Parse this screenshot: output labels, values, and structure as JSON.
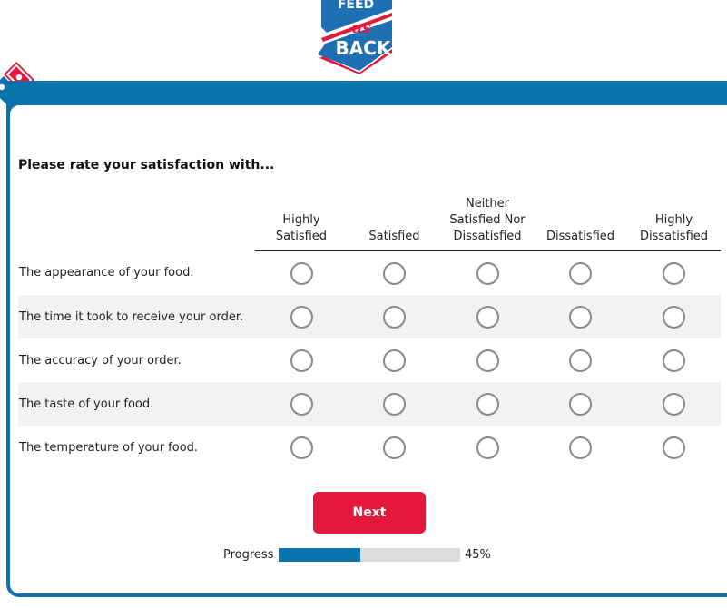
{
  "brand": {
    "logo_lines": [
      "FEED",
      "us",
      "BACK"
    ],
    "accent_blue": "#0b73ab",
    "accent_red": "#e3183a"
  },
  "survey": {
    "question": "Please rate your satisfaction with...",
    "columns": [
      {
        "line1": "",
        "line2": "Highly",
        "line3": "Satisfied"
      },
      {
        "line1": "",
        "line2": "",
        "line3": "Satisfied"
      },
      {
        "line1": "Neither",
        "line2": "Satisfied Nor",
        "line3": "Dissatisfied"
      },
      {
        "line1": "",
        "line2": "",
        "line3": "Dissatisfied"
      },
      {
        "line1": "",
        "line2": "Highly",
        "line3": "Dissatisfied"
      }
    ],
    "rows": [
      "The appearance of your food.",
      "The time it took to receive your order.",
      "The accuracy of your order.",
      "The taste of your food.",
      "The temperature of your food."
    ]
  },
  "navigation": {
    "next_label": "Next"
  },
  "progress": {
    "label": "Progress",
    "value": 0.45,
    "percent_label": "45%"
  }
}
